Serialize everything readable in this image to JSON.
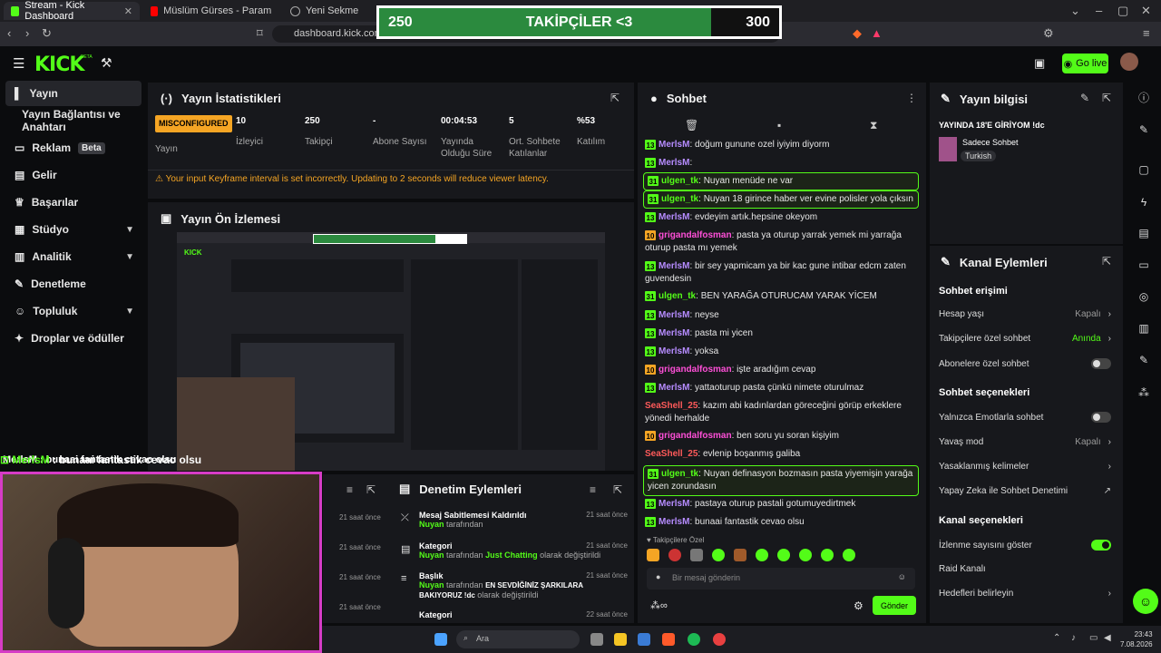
{
  "browser": {
    "tabs": [
      {
        "label": "Stream - Kick Dashboard",
        "active": true
      },
      {
        "label": "Müslüm Gürses - Paramparça - Y",
        "active": false
      },
      {
        "label": "Yeni Sekme",
        "active": false
      }
    ],
    "url": "dashboard.kick.com/str"
  },
  "goal": {
    "current": "250",
    "label": "TAKİPÇİLER <3",
    "target": "300",
    "progress": 0.83
  },
  "header": {
    "logo": "KICK",
    "beta": "BETA",
    "go_live": "Go live"
  },
  "sidebar": {
    "items": [
      {
        "label": "Yayın"
      },
      {
        "label": "Yayın Bağlantısı ve Anahtarı"
      },
      {
        "label": "Reklam",
        "badge": "Beta"
      },
      {
        "label": "Gelir"
      },
      {
        "label": "Başarılar"
      },
      {
        "label": "Stüdyo"
      },
      {
        "label": "Analitik"
      },
      {
        "label": "Denetleme"
      },
      {
        "label": "Topluluk"
      },
      {
        "label": "Droplar ve ödüller"
      }
    ]
  },
  "stats": {
    "title": "Yayın İstatistikleri",
    "status_badge": "MISCONFIGURED",
    "status_label": "Yayın",
    "items": [
      {
        "value": "10",
        "label": "İzleyici"
      },
      {
        "value": "250",
        "label": "Takipçi"
      },
      {
        "value": "-",
        "label": "Abone Sayısı"
      },
      {
        "value": "00:04:53",
        "label": "Yayında Olduğu Süre"
      },
      {
        "value": "5",
        "label": "Ort. Sohbete Katılanlar"
      },
      {
        "value": "%53",
        "label": "Katılım"
      }
    ],
    "warning": "Your input Keyframe interval is set incorrectly. Updating to 2 seconds will reduce viewer latency."
  },
  "preview": {
    "title": "Yayın Ön İzlemesi",
    "overlay_chat": "MerlsM : bunaai fantastik cevao olsu",
    "overlay_user": "MerlsM"
  },
  "audit": {
    "title": "Denetim Eylemleri",
    "left_times": [
      "21 saat önce",
      "21 saat önce",
      "21 saat önce",
      "21 saat önce"
    ],
    "entries": [
      {
        "title": "Mesaj Sabitlemesi Kaldırıldı",
        "user": "Nuyan",
        "text": "tarafından",
        "time": "21 saat önce"
      },
      {
        "title": "Kategori",
        "user": "Nuyan",
        "text": "tarafından",
        "highlight": "Just Chatting",
        "suffix": "olarak değiştirildi",
        "time": "21 saat önce"
      },
      {
        "title": "Başlık",
        "user": "Nuyan",
        "text": "tarafından",
        "highlight": "EN SEVDİĞİNİZ ŞARKILARA BAKIYORUZ !dc",
        "suffix": "olarak değiştirildi",
        "time": "21 saat önce"
      },
      {
        "title": "Kategori",
        "time": "22 saat önce"
      }
    ]
  },
  "chat": {
    "title": "Sohbet",
    "messages": [
      {
        "badge": "13",
        "user": "MerlsM",
        "color": "#b68cff",
        "text": "doğum gunune ozel iyiyim diyorm"
      },
      {
        "badge": "13",
        "user": "MerlsM",
        "color": "#b68cff",
        "text": ""
      },
      {
        "badge": "31",
        "user": "ulgen_tk",
        "color": "#53fc18",
        "text": "Nuyan menüde ne var",
        "hl": true
      },
      {
        "badge": "31",
        "user": "ulgen_tk",
        "color": "#53fc18",
        "text": "Nuyan 18 girince haber ver evine polisler yola çıksın",
        "hl": true
      },
      {
        "badge": "13",
        "user": "MerlsM",
        "color": "#b68cff",
        "text": "evdeyim artık.hepsine okeyom"
      },
      {
        "badge": "10",
        "user": "grigandalfosman",
        "color": "#ff4fd8",
        "text": "pasta ya oturup yarrak yemek mi yarrağa oturup pasta mı yemek"
      },
      {
        "badge": "13",
        "user": "MerlsM",
        "color": "#b68cff",
        "text": "bir sey yapmicam ya bir kac gune intibar edcm zaten guvendesin"
      },
      {
        "badge": "31",
        "user": "ulgen_tk",
        "color": "#53fc18",
        "text": "BEN YARAĞA OTURUCAM YARAK YİCEM"
      },
      {
        "badge": "13",
        "user": "MerlsM",
        "color": "#b68cff",
        "text": "neyse"
      },
      {
        "badge": "13",
        "user": "MerlsM",
        "color": "#b68cff",
        "text": "pasta mi yicen"
      },
      {
        "badge": "13",
        "user": "MerlsM",
        "color": "#b68cff",
        "text": "yoksa"
      },
      {
        "badge": "10",
        "user": "grigandalfosman",
        "color": "#ff4fd8",
        "text": "işte aradığım cevap"
      },
      {
        "badge": "13",
        "user": "MerlsM",
        "color": "#b68cff",
        "text": "yattaoturup pasta çünkü nimete oturulmaz"
      },
      {
        "badge": "",
        "user": "SeaShell_25",
        "color": "#ff5a5a",
        "text": "kazım abi kadınlardan göreceğini görüp erkeklere yönedi herhalde"
      },
      {
        "badge": "10",
        "user": "grigandalfosman",
        "color": "#ff4fd8",
        "text": "ben soru yu soran kişiyim"
      },
      {
        "badge": "",
        "user": "SeaShell_25",
        "color": "#ff5a5a",
        "text": "evlenip boşanmış galiba"
      },
      {
        "badge": "31",
        "user": "ulgen_tk",
        "color": "#53fc18",
        "text": "Nuyan definasyon bozmasın pasta yiyemişin yarağa yicen zorundasın",
        "hl": true
      },
      {
        "badge": "13",
        "user": "MerlsM",
        "color": "#b68cff",
        "text": "pastaya oturup pastali gotumuyedirtmek"
      },
      {
        "badge": "13",
        "user": "MerlsM",
        "color": "#b68cff",
        "text": "bunaai fantastik cevao olsu"
      }
    ],
    "followers_only": "Takipçilere Özel",
    "input_placeholder": "Bir mesaj gönderin",
    "send": "Gönder"
  },
  "stream_info": {
    "title": "Yayın bilgisi",
    "stream_title": "YAYINDA 18'E GİRİYOM !dc",
    "category": "Sadece Sohbet",
    "language": "Turkish"
  },
  "channel_actions": {
    "title": "Kanal Eylemleri",
    "chat_access": "Sohbet erişimi",
    "rows1": [
      {
        "label": "Hesap yaşı",
        "value": "Kapalı",
        "type": "chev"
      },
      {
        "label": "Takipçilere özel sohbet",
        "value": "Anında",
        "type": "chev",
        "green": true
      },
      {
        "label": "Abonelere özel sohbet",
        "value": "",
        "type": "toggle"
      }
    ],
    "chat_options": "Sohbet seçenekleri",
    "rows2": [
      {
        "label": "Yalnızca Emotlarla sohbet",
        "value": "",
        "type": "toggle"
      },
      {
        "label": "Yavaş mod",
        "value": "Kapalı",
        "type": "chev"
      },
      {
        "label": "Yasaklanmış kelimeler",
        "value": "",
        "type": "chev"
      },
      {
        "label": "Yapay Zeka ile Sohbet Denetimi",
        "value": "",
        "type": "ext"
      }
    ],
    "channel_options": "Kanal seçenekleri",
    "rows3": [
      {
        "label": "İzlenme sayısını göster",
        "value": "",
        "type": "toggle-on"
      },
      {
        "label": "Raid Kanalı",
        "value": "",
        "type": "none"
      },
      {
        "label": "Hedefleri belirleyin",
        "value": "",
        "type": "chev"
      }
    ]
  },
  "taskbar": {
    "search": "Ara",
    "time": "23:43",
    "date": "7.08.2026"
  }
}
